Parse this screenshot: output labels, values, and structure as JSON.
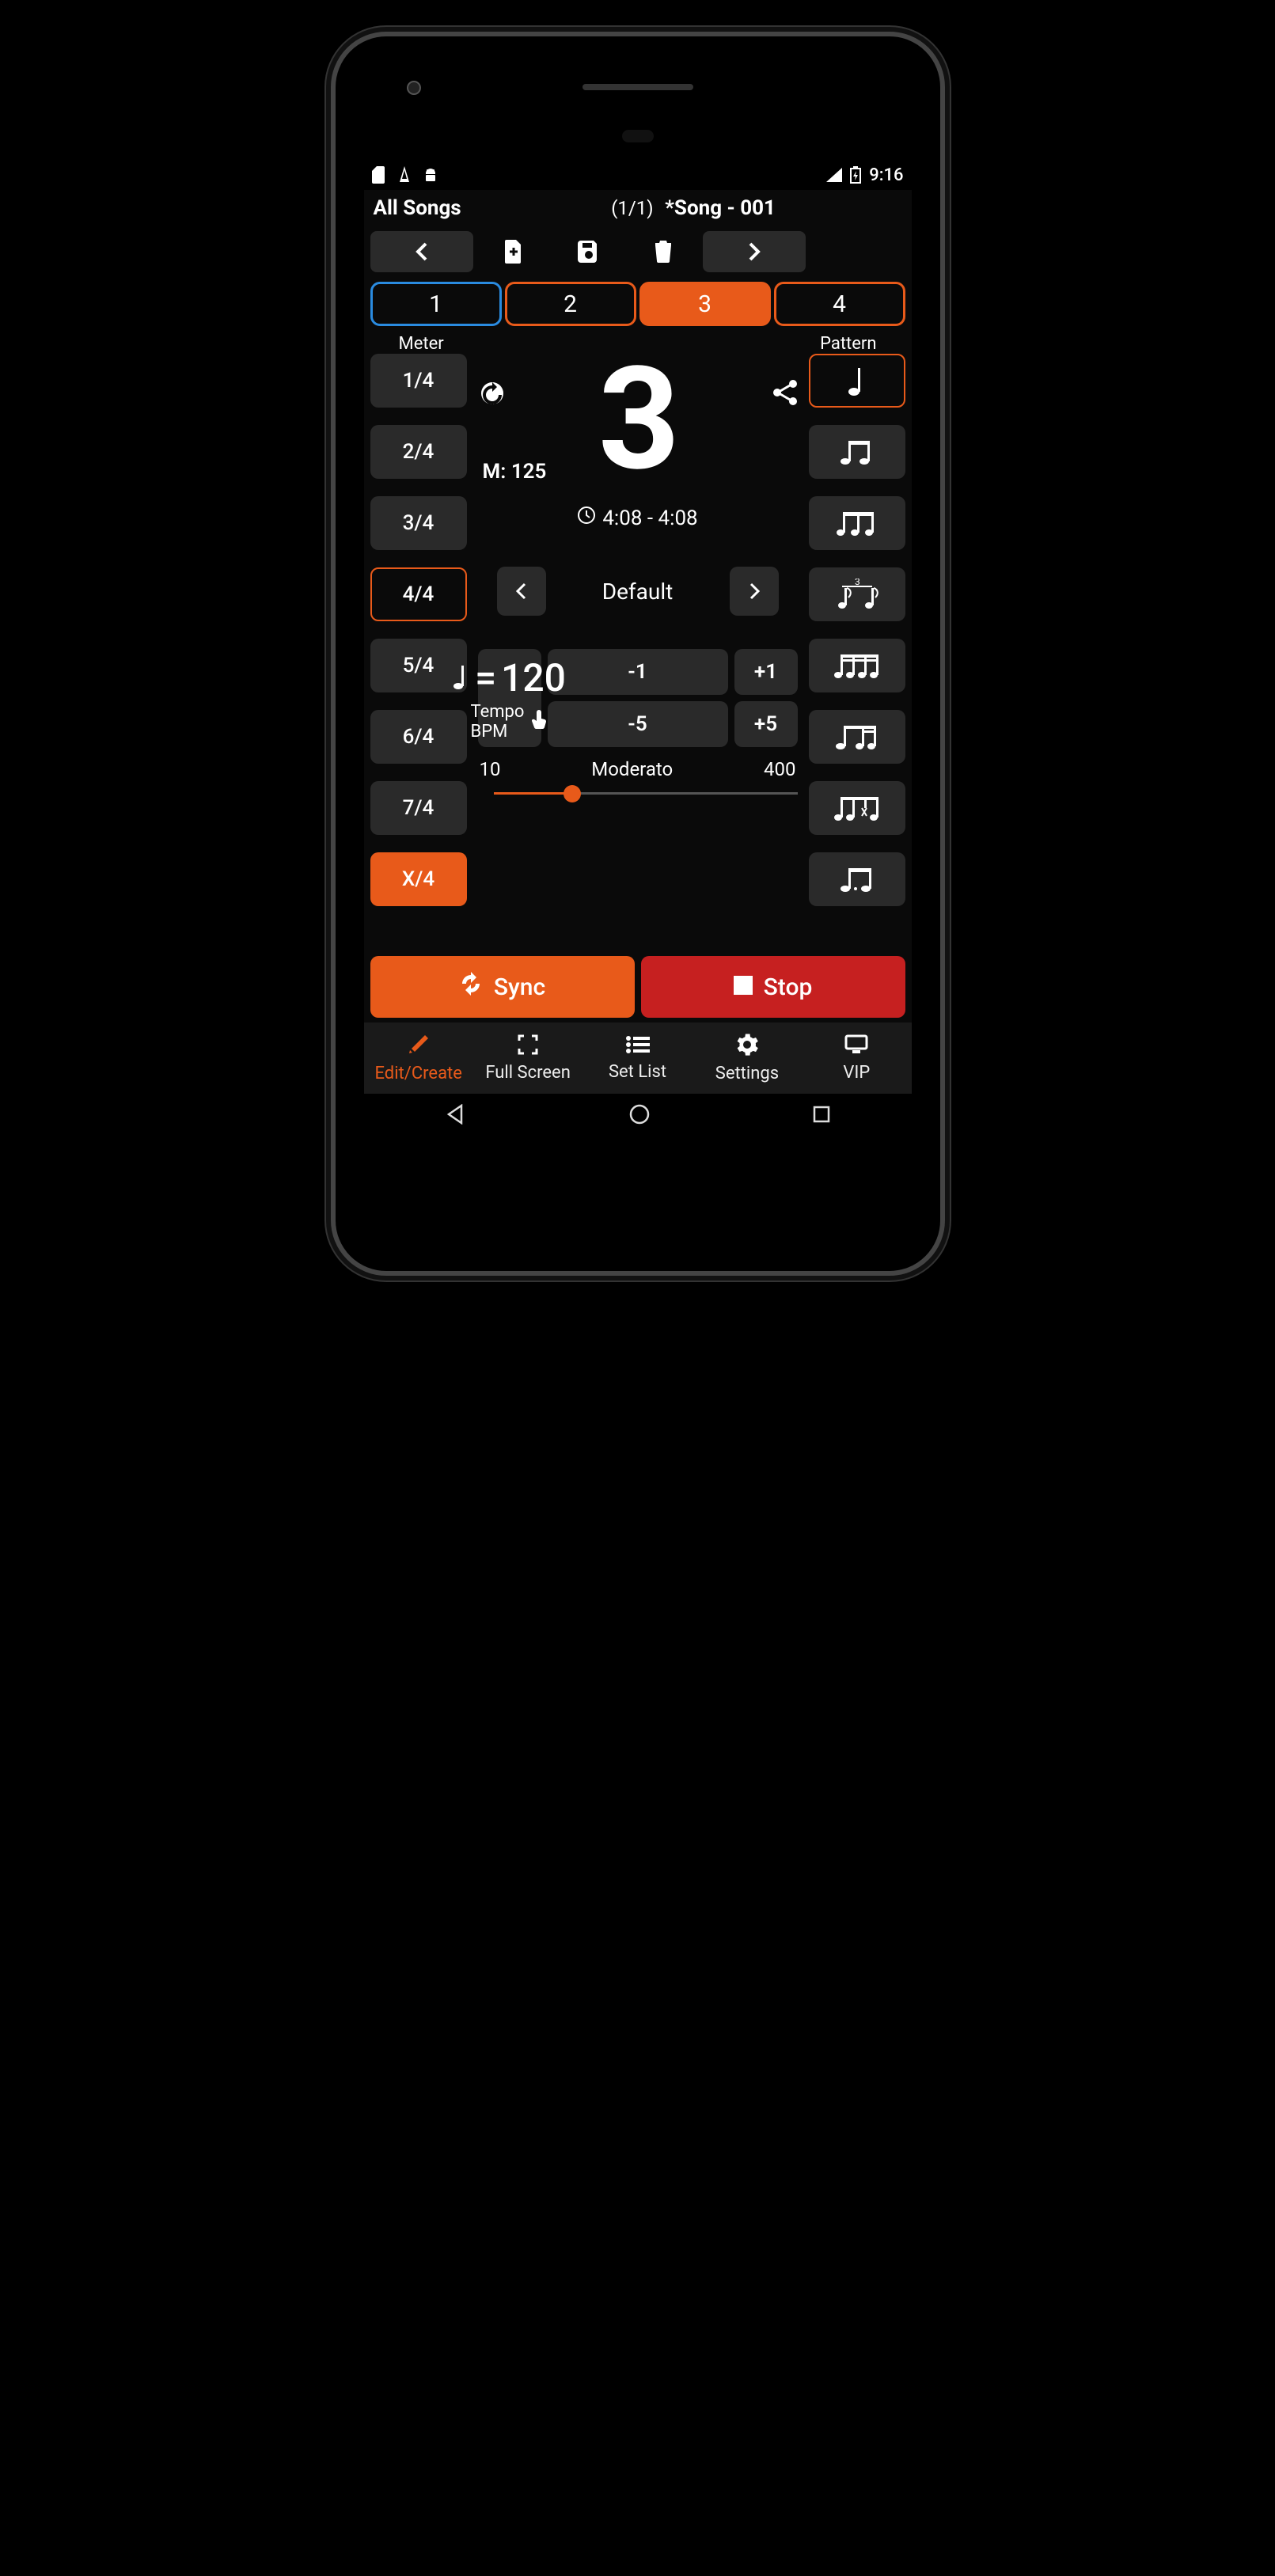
{
  "statusbar": {
    "time": "9:16"
  },
  "header": {
    "list_name": "All Songs",
    "song_index": "(1/1)",
    "song_title": "*Song - 001"
  },
  "beats": {
    "b1": "1",
    "b2": "2",
    "b3": "3",
    "b4": "4"
  },
  "labels": {
    "meter": "Meter",
    "pattern": "Pattern"
  },
  "meters": {
    "m1": "1/4",
    "m2": "2/4",
    "m3": "3/4",
    "m4": "4/4",
    "m5": "5/4",
    "m6": "6/4",
    "m7": "7/4",
    "mx": "X/4"
  },
  "center": {
    "big_beat": "3",
    "m_label": "M:",
    "m_value": "125",
    "time_str": "4:08 - 4:08",
    "preset_name": "Default"
  },
  "tempo": {
    "minus1": "-1",
    "plus1": "+1",
    "minus5": "-5",
    "plus5": "+5",
    "note_eq": "=",
    "value": "120",
    "label": "Tempo BPM",
    "slider_min": "10",
    "slider_name": "Moderato",
    "slider_max": "400"
  },
  "actions": {
    "sync": "Sync",
    "stop": "Stop"
  },
  "nav": {
    "edit": "Edit/Create",
    "fullscreen": "Full Screen",
    "setlist": "Set List",
    "settings": "Settings",
    "vip": "VIP"
  }
}
